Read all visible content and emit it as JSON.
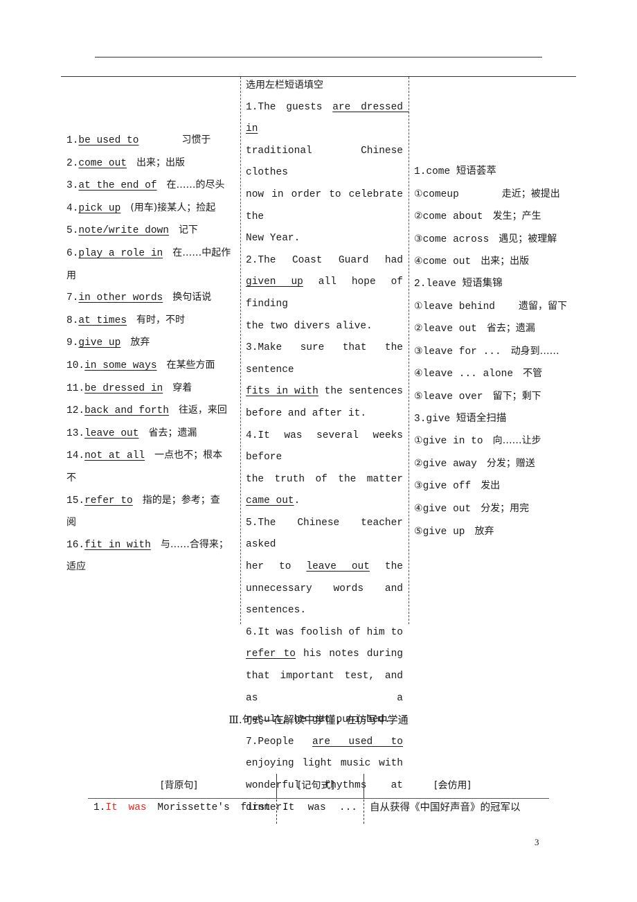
{
  "left_column": {
    "items": [
      {
        "num": "1.",
        "phrase": "be used to",
        "meaning": "习惯于"
      },
      {
        "num": "2.",
        "phrase": "come out",
        "meaning": "出来；出版"
      },
      {
        "num": "3.",
        "phrase": "at the end of",
        "meaning": "在……的尽头"
      },
      {
        "num": "4.",
        "phrase": "pick up",
        "meaning": "(用车)接某人；捡起"
      },
      {
        "num": "5.",
        "phrase": "note/write down",
        "meaning": "记下"
      },
      {
        "num": "6.",
        "phrase": "play a role in",
        "meaning": "在……中起作",
        "meaning_cont": "用"
      },
      {
        "num": "7.",
        "phrase": "in other words",
        "meaning": "换句话说"
      },
      {
        "num": "8.",
        "phrase": "at times",
        "meaning": "有时，不时"
      },
      {
        "num": "9.",
        "phrase": "give up",
        "meaning": "放弃"
      },
      {
        "num": "10.",
        "phrase": "in some ways",
        "meaning": "在某些方面"
      },
      {
        "num": "11.",
        "phrase": "be dressed in",
        "meaning": "穿着"
      },
      {
        "num": "12.",
        "phrase": "back and forth",
        "meaning": "往返，来回"
      },
      {
        "num": "13.",
        "phrase": "leave out",
        "meaning": "省去；遗漏"
      },
      {
        "num": "14.",
        "phrase": "not at all",
        "meaning": "一点也不；根本",
        "meaning_cont": "不"
      },
      {
        "num": "15.",
        "phrase": "refer to",
        "meaning": "指的是；参考；查",
        "meaning_cont": "阅"
      },
      {
        "num": "16.",
        "phrase": "fit in with",
        "meaning": "与……合得来；",
        "meaning_cont": "适应"
      }
    ]
  },
  "middle_column": {
    "heading": "选用左栏短语填空",
    "sentences": [
      {
        "lines": [
          {
            "pre": "1.The guests ",
            "ans": "are dressed in",
            "post": ""
          },
          {
            "pre": "traditional Chinese clothes",
            "ans": "",
            "post": ""
          },
          {
            "pre": "now in order to celebrate the",
            "ans": "",
            "post": ""
          },
          {
            "pre": "New Year.",
            "ans": "",
            "post": "",
            "last": true
          }
        ]
      },
      {
        "lines": [
          {
            "pre": "2.The Coast Guard had",
            "ans": "",
            "post": ""
          },
          {
            "pre": "",
            "ans": "given up",
            "post": " all hope of finding"
          },
          {
            "pre": "the two divers alive.",
            "ans": "",
            "post": "",
            "last": true
          }
        ]
      },
      {
        "lines": [
          {
            "pre": "3.Make sure that the sentence",
            "ans": "",
            "post": ""
          },
          {
            "pre": "",
            "ans": "fits in with",
            "post": " the sentences"
          },
          {
            "pre": "before and after it.",
            "ans": "",
            "post": "",
            "last": true
          }
        ]
      },
      {
        "lines": [
          {
            "pre": "4.It was several weeks before",
            "ans": "",
            "post": ""
          },
          {
            "pre": "the truth of the matter",
            "ans": "",
            "post": ""
          },
          {
            "pre": "",
            "ans": "came out",
            "post": ".",
            "last": true
          }
        ]
      },
      {
        "lines": [
          {
            "pre": "5.The Chinese teacher asked",
            "ans": "",
            "post": ""
          },
          {
            "pre": "her to ",
            "ans": "leave out",
            "post": " the"
          },
          {
            "pre": "unnecessary words and",
            "ans": "",
            "post": ""
          },
          {
            "pre": "sentences.",
            "ans": "",
            "post": "",
            "last": true
          }
        ]
      },
      {
        "lines": [
          {
            "pre": "6.It was foolish of him to",
            "ans": "",
            "post": ""
          },
          {
            "pre": "",
            "ans": "refer to",
            "post": " his notes during"
          },
          {
            "pre": "that important test, and as a",
            "ans": "",
            "post": ""
          },
          {
            "pre": "result, he got punished.",
            "ans": "",
            "post": "",
            "last": true
          }
        ]
      },
      {
        "lines": [
          {
            "pre": "7.People ",
            "ans": "are used to",
            "post": ""
          },
          {
            "pre": "enjoying light music with",
            "ans": "",
            "post": ""
          },
          {
            "pre": "wonderful rhythms at dinner.",
            "ans": "",
            "post": "",
            "last": true
          }
        ]
      }
    ]
  },
  "right_column": {
    "groups": [
      {
        "title": "1.come 短语荟萃",
        "items": [
          {
            "marker": "①",
            "phrase": "comeup",
            "meaning": "走近；被提出"
          },
          {
            "marker": "②",
            "phrase": "come about",
            "meaning": "发生；产生"
          },
          {
            "marker": "③",
            "phrase": "come across",
            "meaning": "遇见；被理解"
          },
          {
            "marker": "④",
            "phrase": "come out",
            "meaning": "出来；出版"
          }
        ]
      },
      {
        "title": "2.leave 短语集锦",
        "items": [
          {
            "marker": "①",
            "phrase": "leave behind",
            "meaning": "遗留，留下"
          },
          {
            "marker": "②",
            "phrase": "leave out",
            "meaning": "省去；遗漏"
          },
          {
            "marker": "③",
            "phrase": "leave for ...",
            "meaning": "动身到……"
          },
          {
            "marker": "④",
            "phrase": "leave ... alone",
            "meaning": "不管"
          },
          {
            "marker": "⑤",
            "phrase": "leave over",
            "meaning": "留下；剩下"
          }
        ]
      },
      {
        "title": "3.give 短语全扫描",
        "items": [
          {
            "marker": "①",
            "phrase": "give in to",
            "meaning": "向……让步"
          },
          {
            "marker": "②",
            "phrase": "give away",
            "meaning": "分发；赠送"
          },
          {
            "marker": "③",
            "phrase": "give off",
            "meaning": "发出"
          },
          {
            "marker": "④",
            "phrase": "give out",
            "meaning": "分发；用完"
          },
          {
            "marker": "⑤",
            "phrase": "give up",
            "meaning": "放弃"
          }
        ]
      }
    ]
  },
  "section": {
    "title": "Ⅲ.句式—在解读中学懂，在仿写中学通"
  },
  "bottom_table": {
    "headers": [
      "[背原句]",
      "[记句式]",
      "[会仿用]"
    ],
    "row1": {
      "num": "1.",
      "highlight": [
        "It",
        "was"
      ],
      "rest": "Morissette's first",
      "pattern": "It was ...",
      "practice": "自从获得《中国好声音》的冠军以"
    },
    "highlight_color": "#e8261f"
  },
  "page_number": "3"
}
